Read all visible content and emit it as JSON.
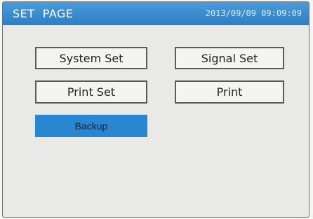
{
  "header": {
    "title": "SET  PAGE",
    "datetime": "2013/09/09 09:09:09"
  },
  "menu": {
    "system_set": "System Set",
    "signal_set": "Signal Set",
    "print_set": "Print Set",
    "print": "Print",
    "backup": "Backup"
  },
  "colors": {
    "titlebar": "#2d7fc4",
    "selected": "#2a86cf"
  }
}
